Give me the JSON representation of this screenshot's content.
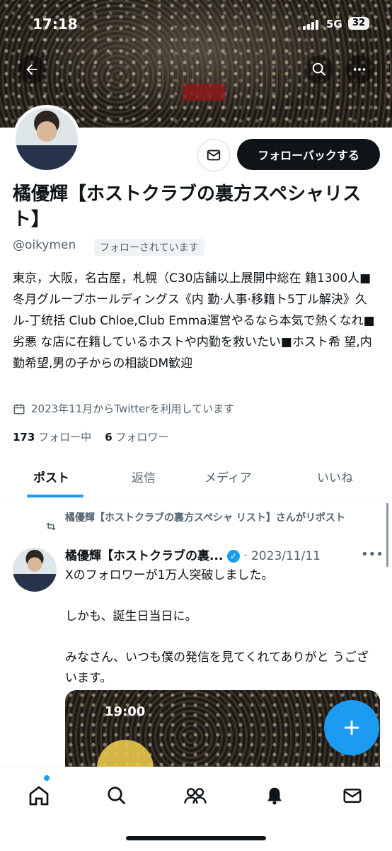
{
  "status_bar": {
    "time": "17:18",
    "network": "5G",
    "battery": "32"
  },
  "profile": {
    "name": "橘優輝【ホストクラブの裏方スペシャリスト】",
    "handle": "@oikymen",
    "follows_you": "フォローされています",
    "follow_button": "フォローバックする",
    "bio": "東京，大阪，名古屋，札幌（C30店舗以上展開中総在 籍1300人■冬月グループホールディングス《内 勤·人事·移籍ト5丁ル解決》久ル-丁统括 Club Chloe,Club Emma運営やるなら本気で熱くなれ■劣悪 な店に在籍しているホストや内勤を救いたい■ホスト希 望,内勤希望,男の子からの相談DM歓迎",
    "joined": "2023年11月からTwitterを利用しています",
    "following_count": "173",
    "following_label": "フォロー中",
    "followers_count": "6",
    "followers_label": "フォロワー"
  },
  "tabs": [
    {
      "label": "ポスト",
      "active": true
    },
    {
      "label": "返信"
    },
    {
      "label": "メディア"
    },
    {
      "label": "いいね"
    }
  ],
  "post": {
    "repost_text": "橘優輝【ホストクラブの裏方スペシャ リスト】さんがリポスト",
    "author": "橘優輝【ホストクラブの裏...",
    "date": "· 2023/11/11",
    "body": "Xのフォロワーが1万人突破しました。\n\nしかも、誕生日当日に。\n\nみなさん、いつも僕の発信を見てくれてありがと うございます。",
    "media_time": "19:00"
  },
  "icons": {
    "back": "arrow-left-icon",
    "search": "search-icon",
    "more": "more-icon",
    "mail": "mail-icon",
    "calendar": "calendar-icon",
    "repost": "repost-icon",
    "verified": "verified-icon",
    "compose": "plus-icon",
    "nav": [
      "home-icon",
      "search-icon",
      "communities-icon",
      "notifications-icon",
      "messages-icon"
    ]
  },
  "colors": {
    "accent": "#1d9bf0",
    "text": "#0f1419",
    "secondary": "#536471"
  }
}
